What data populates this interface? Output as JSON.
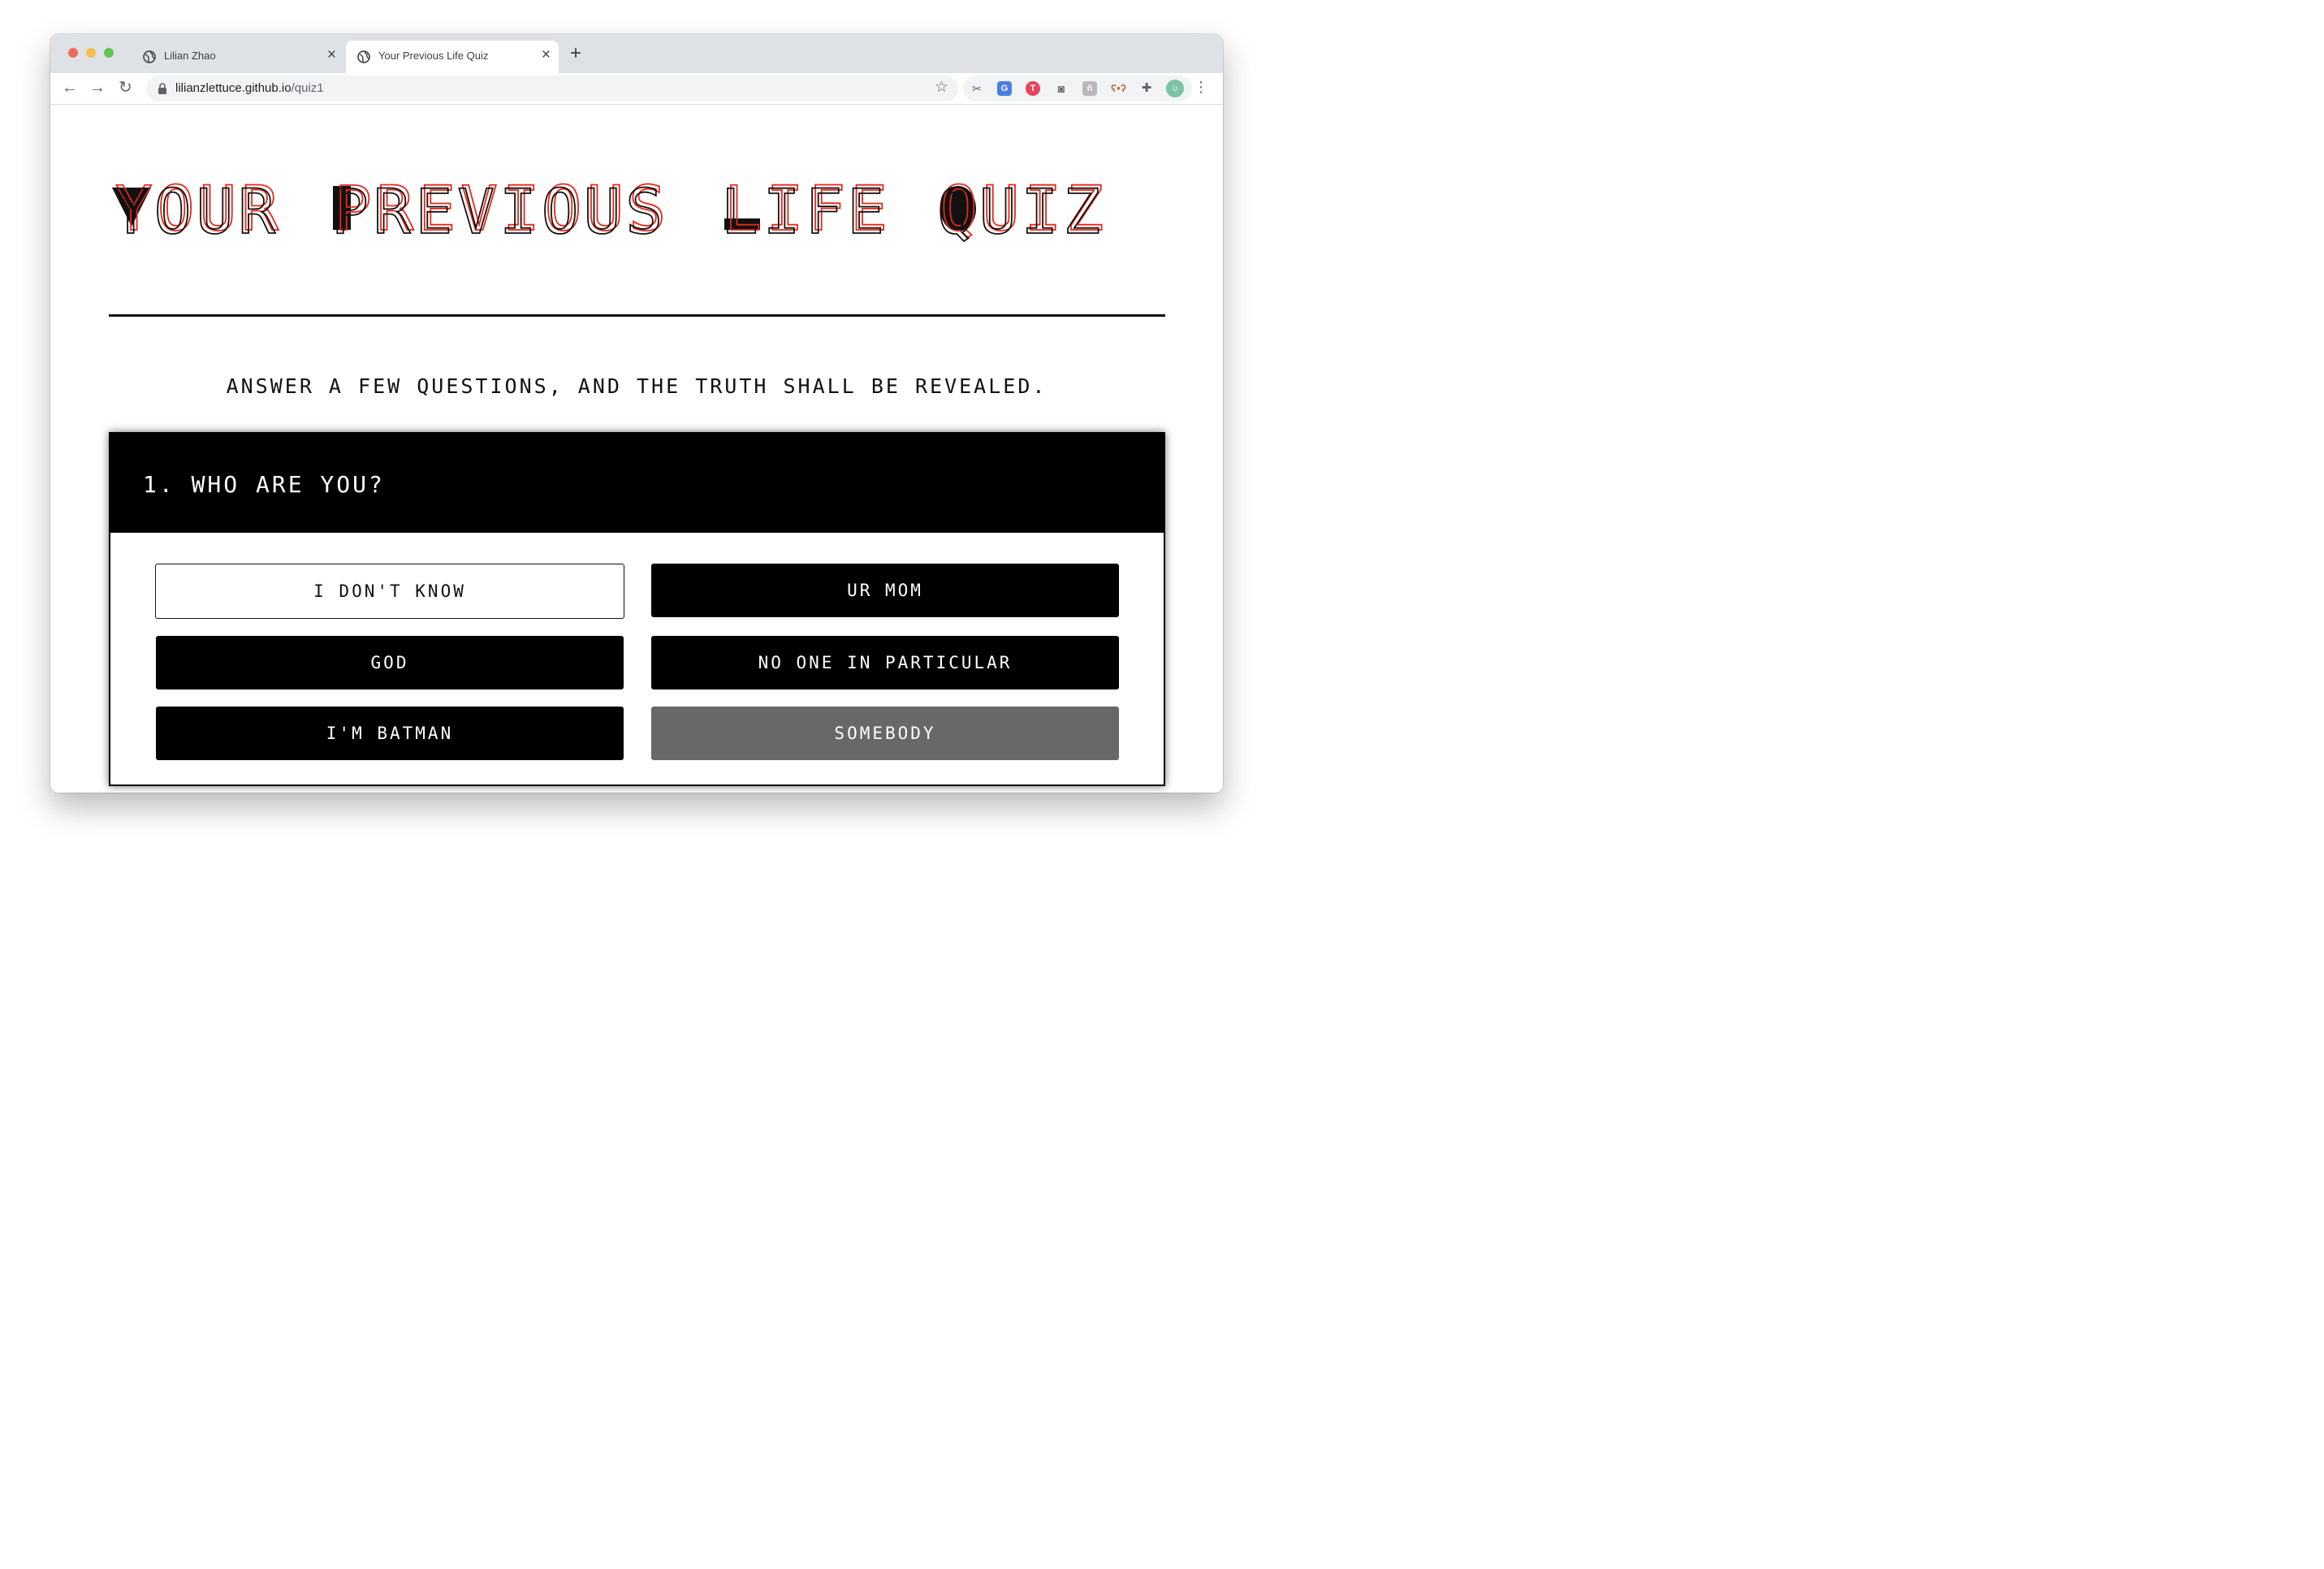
{
  "browser": {
    "tabs": [
      {
        "title": "Lilian Zhao",
        "active": false
      },
      {
        "title": "Your Previous Life Quiz",
        "active": true
      }
    ],
    "url_host": "lilianzlettuce.github.io",
    "url_path": "/quiz1",
    "close_glyph": "×",
    "new_tab_glyph": "+",
    "back_glyph": "←",
    "forward_glyph": "→",
    "reload_glyph": "↻",
    "star_glyph": "☆",
    "menu_glyph": "⋮",
    "extensions": [
      "scissors-extension",
      "google-translate-extension",
      "red-circle-extension",
      "camera-extension",
      "grey-box-extension",
      "bear-extension",
      "puzzle-extensions-icon",
      "profile-avatar"
    ]
  },
  "hero": {
    "title": "YOUR PREVIOUS LIFE QUIZ",
    "words": [
      "YOUR",
      "PREVIOUS",
      "LIFE",
      "QUIZ"
    ],
    "accent_color": "#e8271a",
    "ink_color": "#111111"
  },
  "subtitle": "ANSWER A FEW QUESTIONS, AND THE TRUTH SHALL BE REVEALED.",
  "question": {
    "number": "1.",
    "text": "WHO ARE YOU?",
    "full": "1. WHO ARE YOU?"
  },
  "answers": [
    {
      "label": "I DON'T KNOW",
      "style": "outlined"
    },
    {
      "label": "UR MOM",
      "style": "filled"
    },
    {
      "label": "GOD",
      "style": "filled"
    },
    {
      "label": "NO ONE IN PARTICULAR",
      "style": "filled"
    },
    {
      "label": "I'M BATMAN",
      "style": "filled"
    },
    {
      "label": "SOMEBODY",
      "style": "hovered"
    }
  ]
}
